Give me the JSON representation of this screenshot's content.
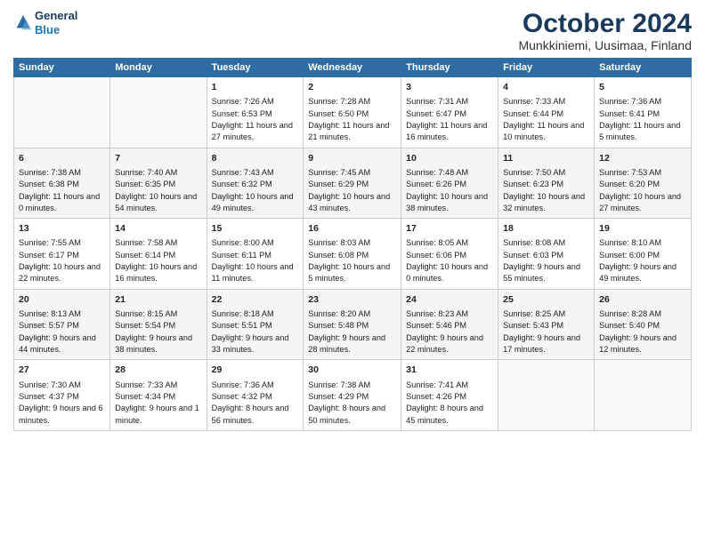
{
  "logo": {
    "line1": "General",
    "line2": "Blue"
  },
  "title": "October 2024",
  "subtitle": "Munkkiniemi, Uusimaa, Finland",
  "weekdays": [
    "Sunday",
    "Monday",
    "Tuesday",
    "Wednesday",
    "Thursday",
    "Friday",
    "Saturday"
  ],
  "weeks": [
    [
      {
        "day": "",
        "content": ""
      },
      {
        "day": "",
        "content": ""
      },
      {
        "day": "1",
        "content": "Sunrise: 7:26 AM\nSunset: 6:53 PM\nDaylight: 11 hours and 27 minutes."
      },
      {
        "day": "2",
        "content": "Sunrise: 7:28 AM\nSunset: 6:50 PM\nDaylight: 11 hours and 21 minutes."
      },
      {
        "day": "3",
        "content": "Sunrise: 7:31 AM\nSunset: 6:47 PM\nDaylight: 11 hours and 16 minutes."
      },
      {
        "day": "4",
        "content": "Sunrise: 7:33 AM\nSunset: 6:44 PM\nDaylight: 11 hours and 10 minutes."
      },
      {
        "day": "5",
        "content": "Sunrise: 7:36 AM\nSunset: 6:41 PM\nDaylight: 11 hours and 5 minutes."
      }
    ],
    [
      {
        "day": "6",
        "content": "Sunrise: 7:38 AM\nSunset: 6:38 PM\nDaylight: 11 hours and 0 minutes."
      },
      {
        "day": "7",
        "content": "Sunrise: 7:40 AM\nSunset: 6:35 PM\nDaylight: 10 hours and 54 minutes."
      },
      {
        "day": "8",
        "content": "Sunrise: 7:43 AM\nSunset: 6:32 PM\nDaylight: 10 hours and 49 minutes."
      },
      {
        "day": "9",
        "content": "Sunrise: 7:45 AM\nSunset: 6:29 PM\nDaylight: 10 hours and 43 minutes."
      },
      {
        "day": "10",
        "content": "Sunrise: 7:48 AM\nSunset: 6:26 PM\nDaylight: 10 hours and 38 minutes."
      },
      {
        "day": "11",
        "content": "Sunrise: 7:50 AM\nSunset: 6:23 PM\nDaylight: 10 hours and 32 minutes."
      },
      {
        "day": "12",
        "content": "Sunrise: 7:53 AM\nSunset: 6:20 PM\nDaylight: 10 hours and 27 minutes."
      }
    ],
    [
      {
        "day": "13",
        "content": "Sunrise: 7:55 AM\nSunset: 6:17 PM\nDaylight: 10 hours and 22 minutes."
      },
      {
        "day": "14",
        "content": "Sunrise: 7:58 AM\nSunset: 6:14 PM\nDaylight: 10 hours and 16 minutes."
      },
      {
        "day": "15",
        "content": "Sunrise: 8:00 AM\nSunset: 6:11 PM\nDaylight: 10 hours and 11 minutes."
      },
      {
        "day": "16",
        "content": "Sunrise: 8:03 AM\nSunset: 6:08 PM\nDaylight: 10 hours and 5 minutes."
      },
      {
        "day": "17",
        "content": "Sunrise: 8:05 AM\nSunset: 6:06 PM\nDaylight: 10 hours and 0 minutes."
      },
      {
        "day": "18",
        "content": "Sunrise: 8:08 AM\nSunset: 6:03 PM\nDaylight: 9 hours and 55 minutes."
      },
      {
        "day": "19",
        "content": "Sunrise: 8:10 AM\nSunset: 6:00 PM\nDaylight: 9 hours and 49 minutes."
      }
    ],
    [
      {
        "day": "20",
        "content": "Sunrise: 8:13 AM\nSunset: 5:57 PM\nDaylight: 9 hours and 44 minutes."
      },
      {
        "day": "21",
        "content": "Sunrise: 8:15 AM\nSunset: 5:54 PM\nDaylight: 9 hours and 38 minutes."
      },
      {
        "day": "22",
        "content": "Sunrise: 8:18 AM\nSunset: 5:51 PM\nDaylight: 9 hours and 33 minutes."
      },
      {
        "day": "23",
        "content": "Sunrise: 8:20 AM\nSunset: 5:48 PM\nDaylight: 9 hours and 28 minutes."
      },
      {
        "day": "24",
        "content": "Sunrise: 8:23 AM\nSunset: 5:46 PM\nDaylight: 9 hours and 22 minutes."
      },
      {
        "day": "25",
        "content": "Sunrise: 8:25 AM\nSunset: 5:43 PM\nDaylight: 9 hours and 17 minutes."
      },
      {
        "day": "26",
        "content": "Sunrise: 8:28 AM\nSunset: 5:40 PM\nDaylight: 9 hours and 12 minutes."
      }
    ],
    [
      {
        "day": "27",
        "content": "Sunrise: 7:30 AM\nSunset: 4:37 PM\nDaylight: 9 hours and 6 minutes."
      },
      {
        "day": "28",
        "content": "Sunrise: 7:33 AM\nSunset: 4:34 PM\nDaylight: 9 hours and 1 minute."
      },
      {
        "day": "29",
        "content": "Sunrise: 7:36 AM\nSunset: 4:32 PM\nDaylight: 8 hours and 56 minutes."
      },
      {
        "day": "30",
        "content": "Sunrise: 7:38 AM\nSunset: 4:29 PM\nDaylight: 8 hours and 50 minutes."
      },
      {
        "day": "31",
        "content": "Sunrise: 7:41 AM\nSunset: 4:26 PM\nDaylight: 8 hours and 45 minutes."
      },
      {
        "day": "",
        "content": ""
      },
      {
        "day": "",
        "content": ""
      }
    ]
  ]
}
